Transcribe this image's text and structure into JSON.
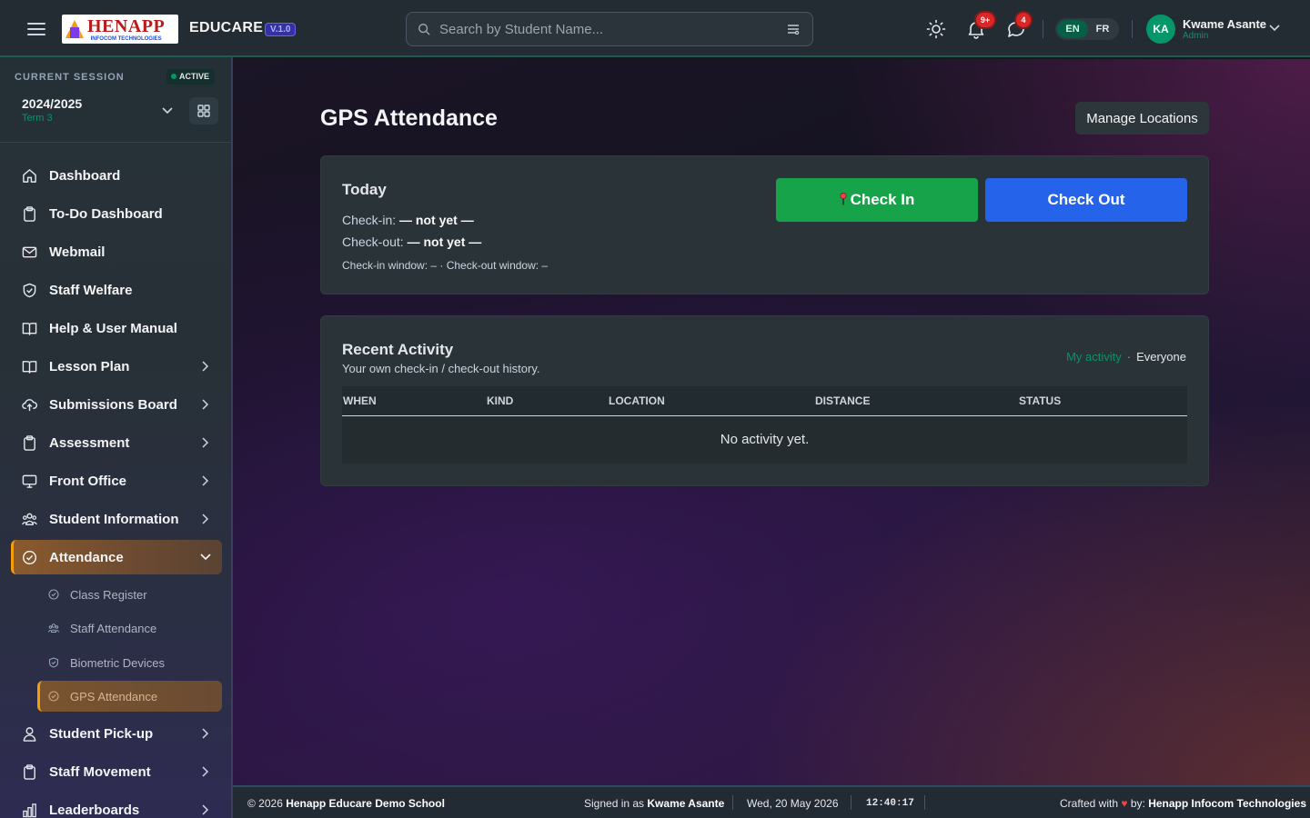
{
  "header": {
    "logo_text": "HENAPP",
    "logo_subtext": "INFOCOM TECHNOLOGIES",
    "brand": "EDUCARE",
    "version": "V.1.0",
    "search_placeholder": "Search by Student Name...",
    "notifications_badge": "9+",
    "messages_badge": "4",
    "languages": [
      "EN",
      "FR"
    ],
    "selected_language": "EN",
    "user": {
      "initials": "KA",
      "name": "Kwame Asante",
      "role": "Admin"
    }
  },
  "session": {
    "label": "CURRENT SESSION",
    "status": "ACTIVE",
    "year": "2024/2025",
    "term": "Term 3"
  },
  "sidebar": {
    "items": [
      {
        "label": "Dashboard",
        "icon": "home-icon",
        "has_children": false
      },
      {
        "label": "To-Do Dashboard",
        "icon": "clipboard-icon",
        "has_children": false
      },
      {
        "label": "Webmail",
        "icon": "mail-icon",
        "has_children": false
      },
      {
        "label": "Staff Welfare",
        "icon": "shield-icon",
        "has_children": false
      },
      {
        "label": "Help & User Manual",
        "icon": "book-icon",
        "has_children": false
      },
      {
        "label": "Lesson Plan",
        "icon": "book-open-icon",
        "has_children": true
      },
      {
        "label": "Submissions Board",
        "icon": "cloud-upload-icon",
        "has_children": true
      },
      {
        "label": "Assessment",
        "icon": "clipboard-icon",
        "has_children": true
      },
      {
        "label": "Front Office",
        "icon": "monitor-icon",
        "has_children": true
      },
      {
        "label": "Student Information",
        "icon": "users-icon",
        "has_children": true
      },
      {
        "label": "Attendance",
        "icon": "check-circle-icon",
        "has_children": true,
        "expanded": true,
        "active": true
      },
      {
        "label": "Student Pick-up",
        "icon": "user-icon",
        "has_children": true
      },
      {
        "label": "Staff Movement",
        "icon": "clipboard-icon",
        "has_children": true
      },
      {
        "label": "Leaderboards",
        "icon": "bar-chart-icon",
        "has_children": true
      }
    ],
    "attendance_children": [
      {
        "label": "Class Register",
        "icon": "check-circle-icon"
      },
      {
        "label": "Staff Attendance",
        "icon": "users-icon"
      },
      {
        "label": "Biometric Devices",
        "icon": "shield-icon"
      },
      {
        "label": "GPS Attendance",
        "icon": "check-circle-icon",
        "active": true
      }
    ]
  },
  "page": {
    "title": "GPS Attendance",
    "manage_button": "Manage Locations",
    "today": {
      "title": "Today",
      "checkin_label": "Check-in:",
      "checkin_value": "— not yet —",
      "checkout_label": "Check-out:",
      "checkout_value": "— not yet —",
      "window_text": "Check-in window: – · Check-out window: –",
      "checkin_button": "Check In",
      "checkout_button": "Check Out"
    },
    "recent": {
      "title": "Recent Activity",
      "subtitle": "Your own check-in / check-out history.",
      "filter_mine": "My activity",
      "filter_sep": "·",
      "filter_all": "Everyone",
      "columns": [
        "WHEN",
        "KIND",
        "LOCATION",
        "DISTANCE",
        "STATUS"
      ],
      "empty_text": "No activity yet."
    }
  },
  "footer": {
    "copyright_prefix": "© 2026",
    "school": "Henapp Educare Demo School",
    "signed_in_prefix": "Signed in as",
    "signed_in_user": "Kwame Asante",
    "date": "Wed, 20 May 2026",
    "time": "12:40:17",
    "crafted_prefix": "Crafted with",
    "crafted_by": "by:",
    "company": "Henapp Infocom Technologies"
  },
  "colors": {
    "accent_green": "#059669",
    "checkin_green": "#16a34a",
    "checkout_blue": "#2563eb",
    "active_amber": "#f59e0b"
  }
}
